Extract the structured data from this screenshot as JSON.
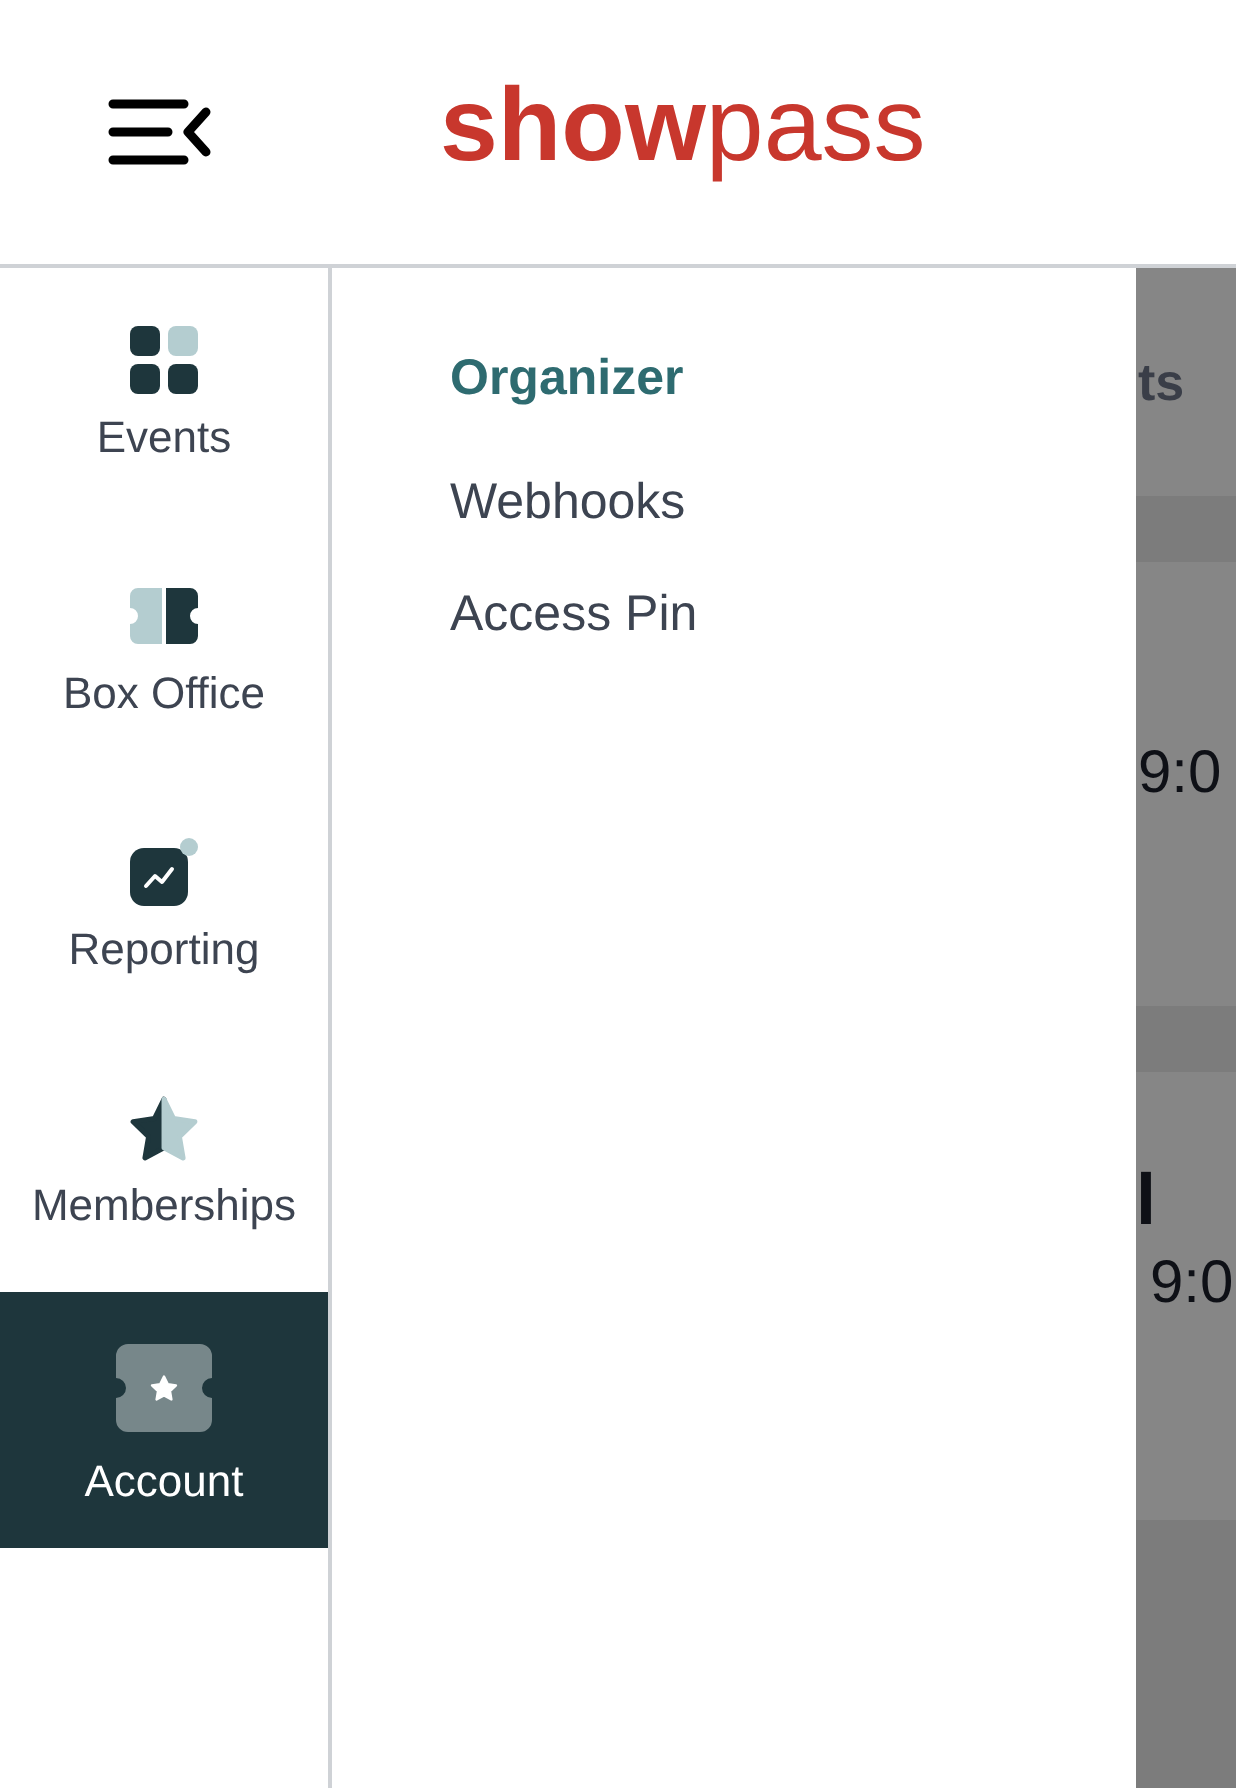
{
  "header": {
    "logo": "**show**pass"
  },
  "sidebar": {
    "items": [
      {
        "label": "Events",
        "selected": false
      },
      {
        "label": "Box Office",
        "selected": false
      },
      {
        "label": "Reporting",
        "selected": false
      },
      {
        "label": "Memberships",
        "selected": false
      },
      {
        "label": "Account",
        "selected": true
      }
    ]
  },
  "submenu": {
    "heading": "Organizer",
    "links": [
      "Webhooks",
      "Access Pin"
    ]
  },
  "background_page": {
    "heading": "ts",
    "cards": [
      {
        "line_2": "9:0"
      },
      {
        "line_1": "l",
        "line_2": "9:0"
      }
    ]
  }
}
